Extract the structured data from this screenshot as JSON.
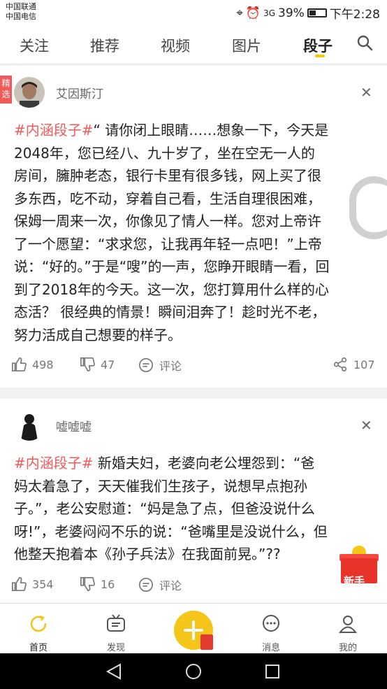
{
  "status": {
    "carrier1": "中国联通",
    "carrier2": "中国电信",
    "network": "3G",
    "battery": "39%",
    "time": "下午2:28"
  },
  "tabs": [
    "关注",
    "推荐",
    "视频",
    "图片",
    "段子"
  ],
  "active_tab": "段子",
  "posts": [
    {
      "badge": "精选",
      "user": "艾因斯汀",
      "tag": "#内涵段子#",
      "lines": [
        "“ 请你闭上眼睛……想象一下，今天是",
        "2048年，您已经八、九十岁了，坐在空无一人的",
        "房间，臃肿老态，银行卡里有很多钱，网上买了很",
        "多东西，吃不动，穿着自己看，生活自理很困难，",
        "保姆一周来一次，你像见了情人一样。您对上帝许",
        "了一个愿望：“求求您，让我再年轻一点吧！”上帝",
        "说：“好的。”于是“嗖”的一声，您睁开眼睛一看，回",
        "到了2018年的今天。这一次，您打算用什么样的心",
        "态活？ 很经典的情景！瞬间泪奔了！趁时光不老，",
        "努力活成自己想要的样子。"
      ],
      "likes": "498",
      "dislikes": "47",
      "comment": "评论",
      "shares": "107"
    },
    {
      "user": "嘘嘘嘘",
      "tag": "#内涵段子#",
      "lines": [
        " 新婚夫妇，老婆向老公埋怨到：“爸",
        "妈太着急了，天天催我们生孩子，说想早点抱孙",
        "子。”，老公安慰道：“妈是急了点，但爸没说什么",
        "呀!”，老婆闷闷不乐的说：“爸嘴里是没说什么，但",
        "他整天抱着本《孙子兵法》在我面前晃。”??"
      ],
      "likes": "354",
      "dislikes": "16",
      "comment": "评论"
    }
  ],
  "gift_label": "新手",
  "bottom_nav": [
    "首页",
    "发现",
    "消息",
    "我的"
  ],
  "colors": {
    "accent": "#f4c61a",
    "tag": "#f15a5a"
  }
}
